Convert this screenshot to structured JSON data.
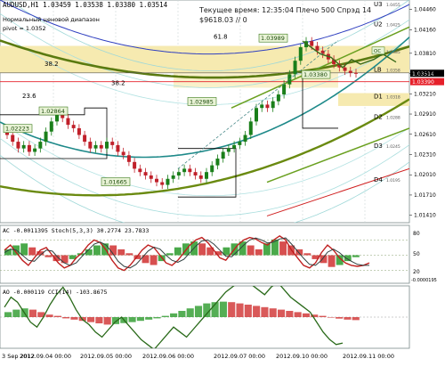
{
  "header": {
    "symbol_line": "AUDUSD,H1  1.03459 1.03538 1.03380 1.03514",
    "subtitle_1": "Нормальный ценовой диапазон",
    "subtitle_2": "pivot = 1.0352",
    "status_line": "Текущее время: 12:35:04  Плечо 500  Спрэд 14",
    "balance_line": "$9618.03   // 0"
  },
  "price_panel": {
    "y_ticks": [
      "1.04460",
      "1.04160",
      "1.03810",
      "1.03510",
      "1.03210",
      "1.02910",
      "1.02610",
      "1.02310",
      "1.02010",
      "1.01710",
      "1.01410"
    ],
    "current_price_tag": "1.03390",
    "last_price_tag": "1.03514",
    "level_labels": [
      {
        "name": "U3",
        "value": 1.0455
      },
      {
        "name": "U2",
        "value": 1.0425
      },
      {
        "name": "U1",
        "value": 1.0385
      },
      {
        "name": "LB",
        "value": 1.0358
      },
      {
        "name": "D1",
        "value": 1.0318
      },
      {
        "name": "D2",
        "value": 1.0288
      },
      {
        "name": "D3",
        "value": 1.0245
      },
      {
        "name": "D4",
        "value": 1.0195
      }
    ],
    "fib_labels": [
      {
        "text": "61.8",
        "value": 1.04
      },
      {
        "text": "38.2",
        "value": 1.036
      },
      {
        "text": "38.2",
        "value": 1.0331
      },
      {
        "text": "23.6",
        "value": 1.0312
      }
    ],
    "price_callouts": [
      {
        "text": "1.03989",
        "value": 1.0399
      },
      {
        "text": "1.02864",
        "value": 1.0291
      },
      {
        "text": "1.02985",
        "value": 1.0305
      },
      {
        "text": "1.03380",
        "value": 1.0345
      },
      {
        "text": "1.02223",
        "value": 1.0265
      },
      {
        "text": "1.01665",
        "value": 1.0186
      }
    ],
    "tag_oc": "OC"
  },
  "ac_stoch_panel": {
    "title": "AC -0.0011395  Stoch(5,3,3) 30.2774  23.7833",
    "y_ticks": [
      "80",
      "50",
      "20",
      "-0.0000195"
    ]
  },
  "ao_cci_panel": {
    "title": "AO -0.000119  CCI(14) -103.8675"
  },
  "x_axis_labels": [
    "3 Sep 2012",
    "2012.09.04 00:00",
    "2012.09.05 00:00",
    "2012.09.06 00:00",
    "2012.09.07 00:00",
    "2012.09.10 00:00",
    "2012.09.11 00:00"
  ],
  "chart_data": {
    "type": "candlestick",
    "symbol": "AUDUSD",
    "timeframe": "H1",
    "ylim": [
      1.013,
      1.046
    ],
    "close_series": [
      1.026,
      1.025,
      1.024,
      1.0245,
      1.0235,
      1.024,
      1.025,
      1.0265,
      1.028,
      1.029,
      1.0285,
      1.0275,
      1.027,
      1.026,
      1.025,
      1.024,
      1.0245,
      1.024,
      1.025,
      1.0245,
      1.0235,
      1.023,
      1.022,
      1.021,
      1.0205,
      1.02,
      1.0195,
      1.019,
      1.0186,
      1.0195,
      1.02,
      1.0205,
      1.021,
      1.0205,
      1.02,
      1.0195,
      1.0205,
      1.0215,
      1.0225,
      1.0235,
      1.024,
      1.0245,
      1.025,
      1.026,
      1.028,
      1.03,
      1.0305,
      1.03,
      1.031,
      1.032,
      1.0335,
      1.035,
      1.037,
      1.039,
      1.0399,
      1.0392,
      1.0385,
      1.038,
      1.0372,
      1.0365,
      1.036,
      1.0355,
      1.0352,
      1.0351
    ],
    "stoch_k": [
      60,
      70,
      55,
      40,
      30,
      45,
      60,
      65,
      50,
      35,
      25,
      30,
      45,
      55,
      70,
      80,
      75,
      60,
      40,
      25,
      20,
      30,
      45,
      60,
      70,
      65,
      50,
      35,
      30,
      40,
      55,
      70,
      80,
      85,
      75,
      60,
      45,
      40,
      55,
      70,
      80,
      85,
      82,
      75,
      70,
      80,
      88,
      80,
      60,
      45,
      30,
      25,
      35,
      55,
      70,
      60,
      45,
      35,
      30,
      28,
      30,
      35
    ],
    "stoch_d": [
      55,
      62,
      60,
      50,
      40,
      38,
      50,
      60,
      58,
      45,
      35,
      30,
      35,
      48,
      60,
      72,
      76,
      70,
      55,
      38,
      28,
      25,
      32,
      45,
      58,
      66,
      62,
      50,
      40,
      36,
      42,
      55,
      68,
      78,
      80,
      72,
      60,
      48,
      47,
      58,
      70,
      80,
      84,
      80,
      74,
      76,
      82,
      84,
      72,
      58,
      44,
      32,
      30,
      40,
      56,
      62,
      55,
      45,
      38,
      32,
      30,
      30
    ],
    "cci": [
      40,
      80,
      60,
      20,
      -20,
      -40,
      0,
      50,
      90,
      120,
      80,
      30,
      -10,
      -30,
      -60,
      -80,
      -50,
      -20,
      0,
      -30,
      -60,
      -90,
      -110,
      -130,
      -100,
      -70,
      -40,
      -60,
      -80,
      -50,
      -20,
      10,
      40,
      70,
      100,
      120,
      140,
      150,
      130,
      110,
      90,
      120,
      140,
      110,
      80,
      60,
      40,
      20,
      -20,
      -60,
      -90,
      -110,
      -104
    ],
    "ao_hist": [
      0.2,
      0.3,
      0.35,
      0.3,
      0.2,
      0.1,
      0.05,
      -0.05,
      -0.1,
      -0.15,
      -0.2,
      -0.25,
      -0.3,
      -0.28,
      -0.24,
      -0.2,
      -0.15,
      -0.1,
      -0.05,
      0.05,
      0.15,
      0.25,
      0.35,
      0.45,
      0.55,
      0.6,
      0.62,
      0.6,
      0.55,
      0.5,
      0.45,
      0.4,
      0.35,
      0.3,
      0.25,
      0.2,
      0.15,
      0.1,
      0.05,
      -0.02,
      -0.06,
      -0.1,
      -0.12
    ],
    "ac_hist": [
      0.3,
      0.5,
      0.6,
      0.4,
      0.2,
      -0.1,
      -0.3,
      -0.4,
      -0.2,
      0.1,
      0.3,
      0.5,
      0.6,
      0.5,
      0.3,
      0.1,
      -0.2,
      -0.4,
      -0.5,
      -0.3,
      0.1,
      0.4,
      0.6,
      0.7,
      0.6,
      0.4,
      0.2,
      0.4,
      0.6,
      0.7,
      0.5,
      0.3,
      0.6,
      0.8,
      0.7,
      0.5,
      0.3,
      0.1,
      -0.2,
      -0.4,
      -0.6,
      -0.5,
      -0.3,
      -0.1
    ]
  },
  "colors": {
    "bull": "#1a7f1a",
    "bear": "#c0202a",
    "band_yellow": "#f6eab0",
    "accent_red": "#e6202a",
    "teal": "#1f8a8a",
    "olive": "#6a8a10",
    "grid": "#cfd8d8"
  }
}
